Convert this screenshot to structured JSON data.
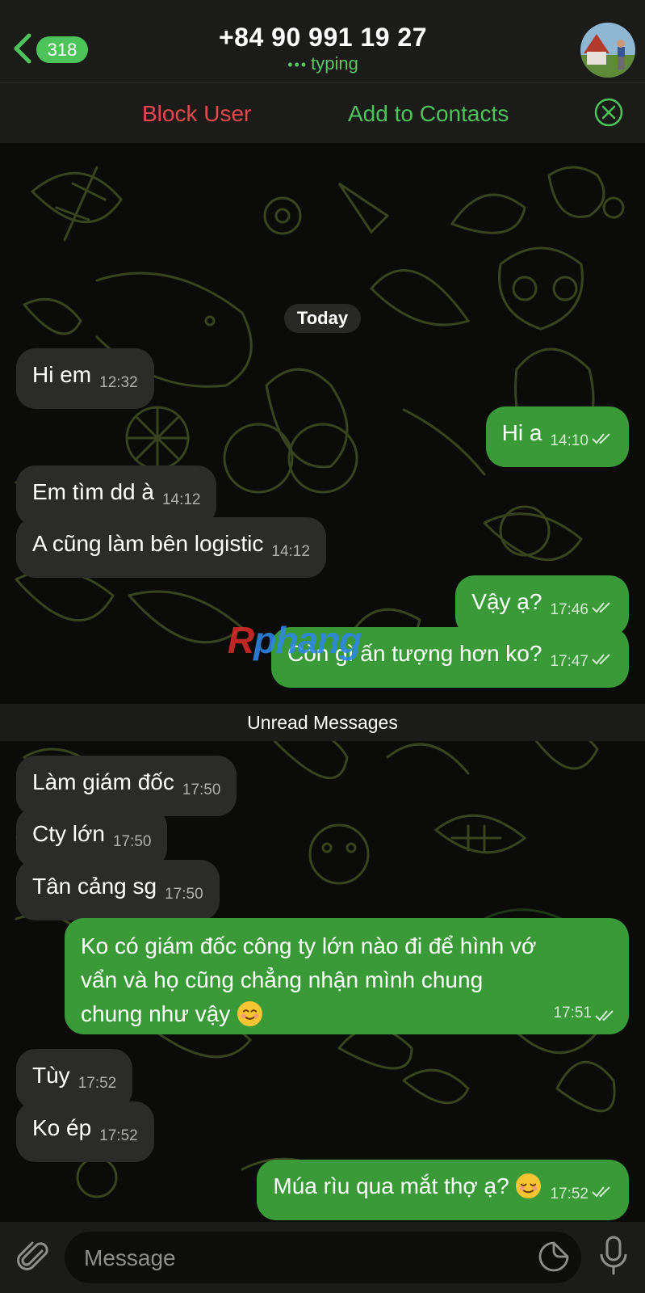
{
  "header": {
    "back_count": "318",
    "title": "+84 90 991 19 27",
    "status": "typing"
  },
  "action_bar": {
    "block_label": "Block User",
    "add_label": "Add to Contacts"
  },
  "chat": {
    "date_label": "Today",
    "unread_label": "Unread Messages",
    "watermark": {
      "part1": "R",
      "part2": "phang"
    },
    "messages": [
      {
        "dir": "in",
        "text": "Hi em",
        "time": "12:32"
      },
      {
        "dir": "out",
        "text": "Hi a",
        "time": "14:10"
      },
      {
        "dir": "in",
        "text": "Em tìm dd à",
        "time": "14:12"
      },
      {
        "dir": "in",
        "text": "A cũng làm bên logistic",
        "time": "14:12"
      },
      {
        "dir": "out",
        "text": "Vậy ạ?",
        "time": "17:46"
      },
      {
        "dir": "out",
        "text": "Còn gì ấn tượng hơn ko?",
        "time": "17:47"
      },
      {
        "dir": "in",
        "text": "Làm giám đốc",
        "time": "17:50"
      },
      {
        "dir": "in",
        "text": "Cty lớn",
        "time": "17:50"
      },
      {
        "dir": "in",
        "text": "Tân cảng sg",
        "time": "17:50"
      },
      {
        "dir": "out",
        "text_lines": [
          "Ko có giám đốc công ty lớn nào đi để hình vớ",
          "vẩn và họ cũng chẳng nhận mình chung",
          "chung như vậy"
        ],
        "time": "17:51"
      },
      {
        "dir": "in",
        "text": "Tùy",
        "time": "17:52"
      },
      {
        "dir": "in",
        "text": "Ko ép",
        "time": "17:52"
      },
      {
        "dir": "out",
        "text": "Múa rìu qua mắt thợ ạ?",
        "time": "17:52"
      }
    ]
  },
  "composer": {
    "placeholder": "Message"
  },
  "colors": {
    "accent": "#4cc45a",
    "block": "#e5484d",
    "outgoing_bubble": "#3a9a37",
    "incoming_bubble": "#2b2c29"
  },
  "icons": [
    "chevron-left-icon",
    "close-circle-icon",
    "paperclip-icon",
    "sticker-icon",
    "microphone-icon",
    "double-check-icon"
  ]
}
